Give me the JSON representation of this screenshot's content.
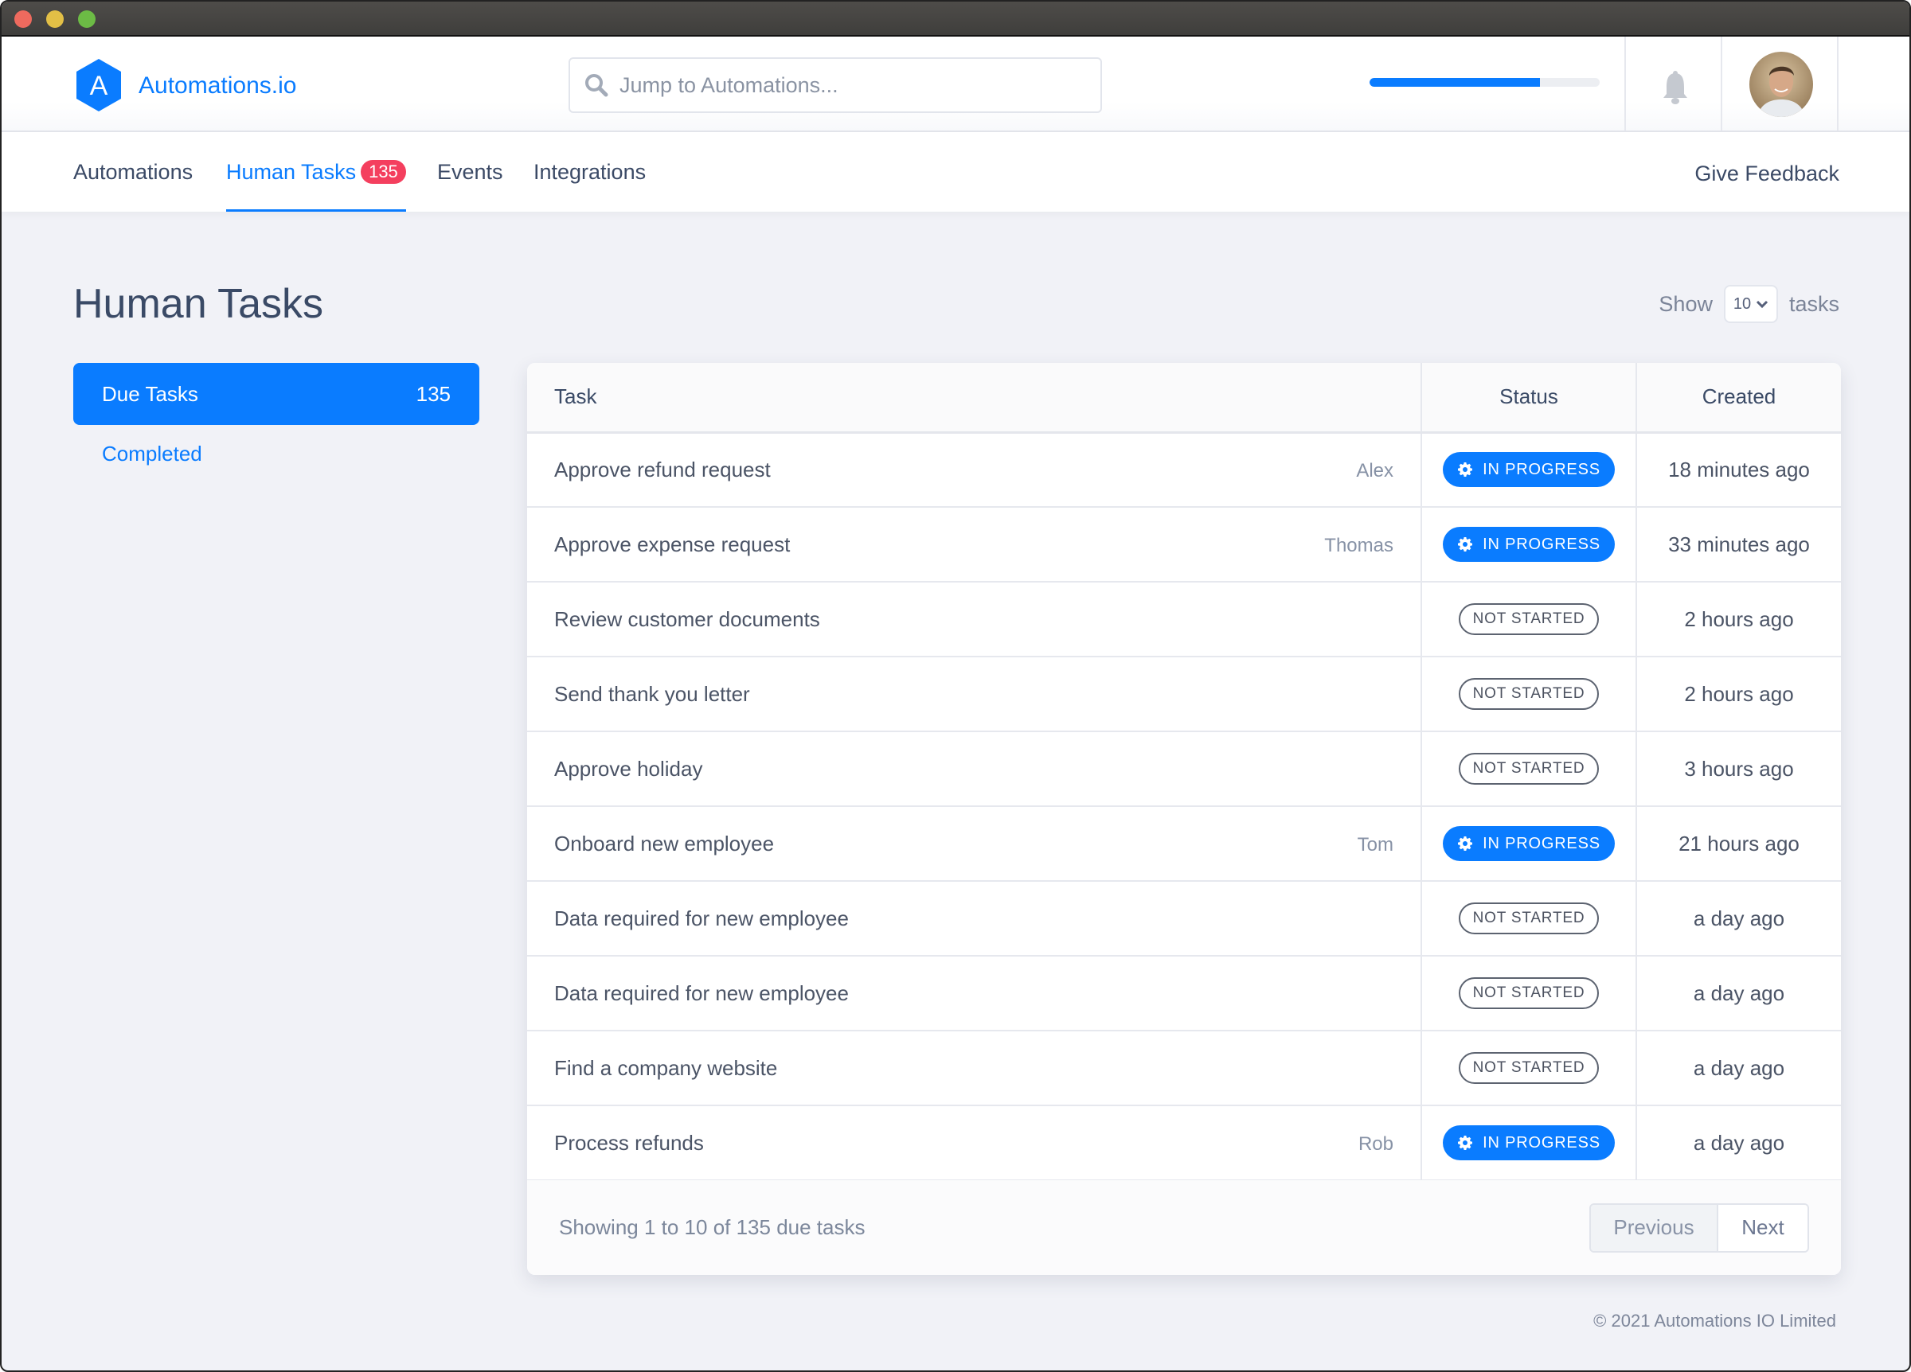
{
  "window": {
    "controls": [
      "close",
      "minimize",
      "maximize"
    ]
  },
  "header": {
    "brand": "Automations.io",
    "logo_letter": "A",
    "search": {
      "placeholder": "Jump to Automations...",
      "value": ""
    },
    "progress_percent": 74,
    "icons": {
      "notifications": "bell-icon",
      "user": "avatar"
    }
  },
  "nav": {
    "tabs": [
      {
        "label": "Automations",
        "active": false
      },
      {
        "label": "Human Tasks",
        "active": true,
        "badge": "135"
      },
      {
        "label": "Events",
        "active": false
      },
      {
        "label": "Integrations",
        "active": false
      }
    ],
    "feedback_label": "Give Feedback"
  },
  "page": {
    "title": "Human Tasks",
    "show": {
      "prefix": "Show",
      "value": "10",
      "suffix": "tasks"
    }
  },
  "sidebar": {
    "items": [
      {
        "label": "Due Tasks",
        "count": "135",
        "active": true
      },
      {
        "label": "Completed",
        "active": false
      }
    ]
  },
  "table": {
    "columns": [
      "Task",
      "Status",
      "Created"
    ],
    "rows": [
      {
        "task": "Approve refund request",
        "assignee": "Alex",
        "status": "IN PROGRESS",
        "created": "18 minutes ago"
      },
      {
        "task": "Approve expense request",
        "assignee": "Thomas",
        "status": "IN PROGRESS",
        "created": "33 minutes ago"
      },
      {
        "task": "Review customer documents",
        "assignee": "",
        "status": "NOT STARTED",
        "created": "2 hours ago"
      },
      {
        "task": "Send thank you letter",
        "assignee": "",
        "status": "NOT STARTED",
        "created": "2 hours ago"
      },
      {
        "task": "Approve holiday",
        "assignee": "",
        "status": "NOT STARTED",
        "created": "3 hours ago"
      },
      {
        "task": "Onboard new employee",
        "assignee": "Tom",
        "status": "IN PROGRESS",
        "created": "21 hours ago"
      },
      {
        "task": "Data required for new employee",
        "assignee": "",
        "status": "NOT STARTED",
        "created": "a day ago"
      },
      {
        "task": "Data required for new employee",
        "assignee": "",
        "status": "NOT STARTED",
        "created": "a day ago"
      },
      {
        "task": "Find a company website",
        "assignee": "",
        "status": "NOT STARTED",
        "created": "a day ago"
      },
      {
        "task": "Process refunds",
        "assignee": "Rob",
        "status": "IN PROGRESS",
        "created": "a day ago"
      }
    ],
    "footer": {
      "showing": "Showing 1 to 10 of 135 due tasks",
      "previous_label": "Previous",
      "next_label": "Next"
    }
  },
  "footer": {
    "copyright": "© 2021 Automations IO Limited"
  },
  "colors": {
    "accent": "#0a7cff",
    "badge": "#f43f5e",
    "background": "#f1f2f7"
  }
}
